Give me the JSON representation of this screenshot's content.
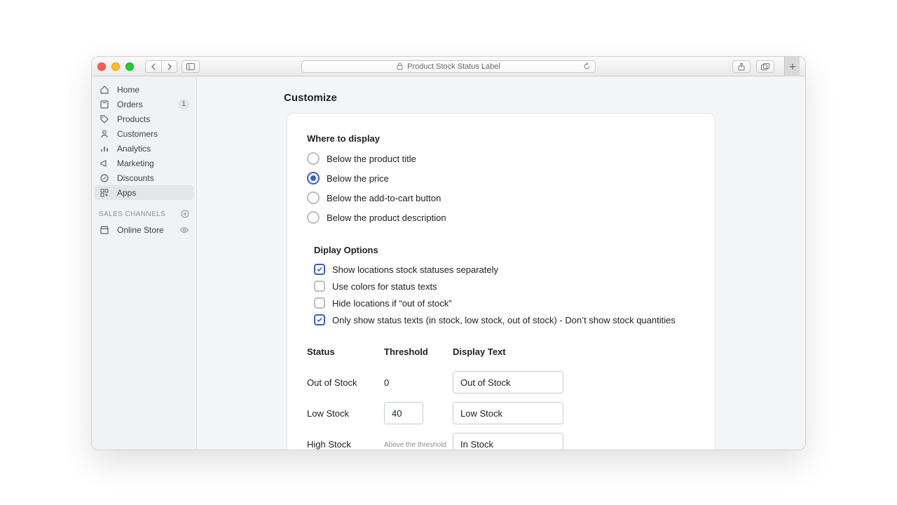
{
  "titlebar": {
    "address_text": "Product Stock Status Label"
  },
  "sidebar": {
    "items": [
      {
        "label": "Home"
      },
      {
        "label": "Orders",
        "badge": "1"
      },
      {
        "label": "Products"
      },
      {
        "label": "Customers"
      },
      {
        "label": "Analytics"
      },
      {
        "label": "Marketing"
      },
      {
        "label": "Discounts"
      },
      {
        "label": "Apps"
      }
    ],
    "sales_heading": "SALES CHANNELS",
    "channels": [
      {
        "label": "Online Store"
      }
    ]
  },
  "page": {
    "title": "Customize",
    "where_title": "Where to display",
    "where_options": [
      {
        "label": "Below the product title",
        "checked": false
      },
      {
        "label": "Below the price",
        "checked": true
      },
      {
        "label": "Below the add-to-cart button",
        "checked": false
      },
      {
        "label": "Below the product description",
        "checked": false
      }
    ],
    "display_title": "Diplay Options",
    "display_options": [
      {
        "label": "Show locations stock statuses separately",
        "checked": true
      },
      {
        "label": "Use colors for status texts",
        "checked": false
      },
      {
        "label": "Hide locations if “out of stock”",
        "checked": false
      },
      {
        "label": "Only show status texts (in stock, low stock, out of stock) - Don’t show stock quantities",
        "checked": true
      }
    ],
    "table": {
      "headers": {
        "status": "Status",
        "threshold": "Threshold",
        "display": "Display Text"
      },
      "rows": [
        {
          "status": "Out of Stock",
          "threshold_text": "0",
          "threshold_input": "",
          "display": "Out of Stock"
        },
        {
          "status": "Low Stock",
          "threshold_text": "",
          "threshold_input": "40",
          "display": "Low Stock"
        },
        {
          "status": "High Stock",
          "threshold_text": "",
          "threshold_hint": "Above the threshold",
          "display": "In Stock"
        }
      ]
    }
  }
}
